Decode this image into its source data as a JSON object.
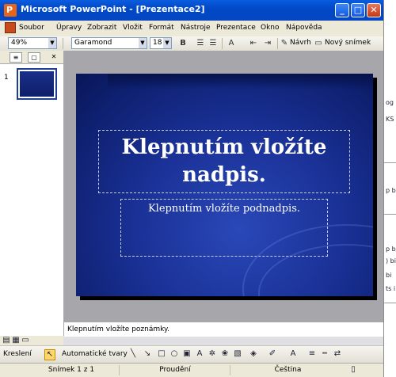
{
  "window": {
    "title": "Microsoft PowerPoint - [Prezentace2]"
  },
  "menu": [
    "Soubor",
    "Úpravy",
    "Zobrazit",
    "Vložit",
    "Formát",
    "Nástroje",
    "Prezentace",
    "Okno",
    "Nápověda"
  ],
  "toolbar": {
    "zoom": "49%",
    "font": "Garamond",
    "size": "18",
    "bold_label": "B",
    "design_label": "Návrh",
    "new_slide_label": "Nový snímek"
  },
  "slide_pane": {
    "slide_number": "1"
  },
  "slide": {
    "title_placeholder": "Klepnutím vložíte nadpis.",
    "subtitle_placeholder": "Klepnutím vložíte podnadpis."
  },
  "notes": {
    "placeholder": "Klepnutím vložíte poznámky."
  },
  "drawing": {
    "draw_label": "Kreslení",
    "autoshapes_label": "Automatické tvary"
  },
  "status": {
    "slide": "Snímek 1 z 1",
    "design": "Proudění",
    "language": "Čeština"
  },
  "background_window": {
    "snippets": [
      "og",
      "KS",
      "p b",
      "p b",
      ") bi",
      "bi",
      "ts i"
    ]
  }
}
